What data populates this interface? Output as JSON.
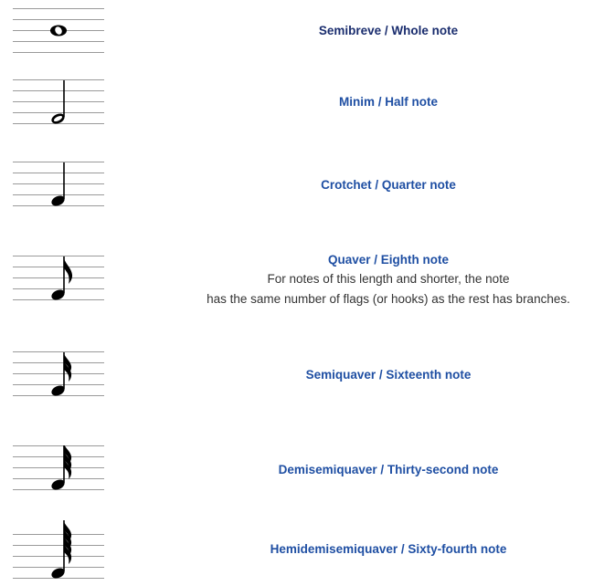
{
  "notes": [
    {
      "name": "Semibreve / Whole note",
      "flags": 0,
      "kind": "whole"
    },
    {
      "name": "Minim / Half note",
      "flags": 0,
      "kind": "half"
    },
    {
      "name": "Crotchet / Quarter note",
      "flags": 0,
      "kind": "quarter"
    },
    {
      "name": "Quaver / Eighth note",
      "flags": 1,
      "kind": "flagged",
      "description_line1": "For notes of this length and shorter, the note",
      "description_line2": "has the same number of flags (or hooks) as the rest has branches."
    },
    {
      "name": "Semiquaver / Sixteenth note",
      "flags": 2,
      "kind": "flagged"
    },
    {
      "name": "Demisemiquaver / Thirty-second note",
      "flags": 3,
      "kind": "flagged"
    },
    {
      "name": "Hemidemisemiquaver / Sixty-fourth note",
      "flags": 4,
      "kind": "flagged"
    }
  ],
  "colors": {
    "title": "#1f4fa3",
    "title_dark": "#1a2d6e",
    "body_text": "#333333",
    "staff_line": "#9a9a9a",
    "note": "#000000"
  }
}
